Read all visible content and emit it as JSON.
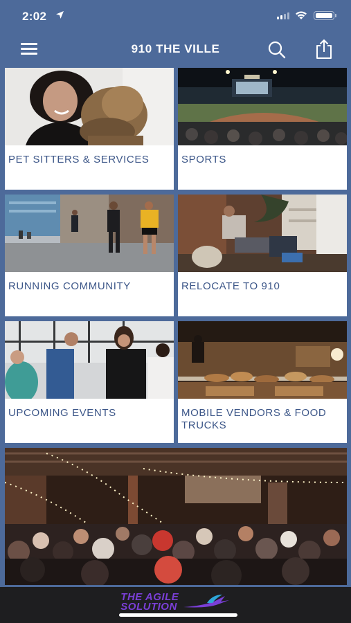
{
  "status": {
    "time": "2:02"
  },
  "nav": {
    "title": "910 THE VILLE"
  },
  "tiles": [
    {
      "label": "PET SITTERS & SERVICES"
    },
    {
      "label": "SPORTS"
    },
    {
      "label": "RUNNING COMMUNITY"
    },
    {
      "label": "RELOCATE TO 910"
    },
    {
      "label": "UPCOMING EVENTS"
    },
    {
      "label": "MOBILE VENDORS & FOOD TRUCKS"
    }
  ],
  "footer": {
    "logo_line1": "THE AGILE",
    "logo_line2": "SOLUTION"
  },
  "colors": {
    "bar": "#4d6a9a",
    "label": "#3c5688",
    "footer": "#1e1e20",
    "logo": "#7a3fd6"
  },
  "icons": [
    "location-arrow-icon",
    "signal-icon",
    "wifi-icon",
    "battery-icon",
    "hamburger-menu-icon",
    "search-icon",
    "share-icon",
    "hummingbird-icon"
  ]
}
